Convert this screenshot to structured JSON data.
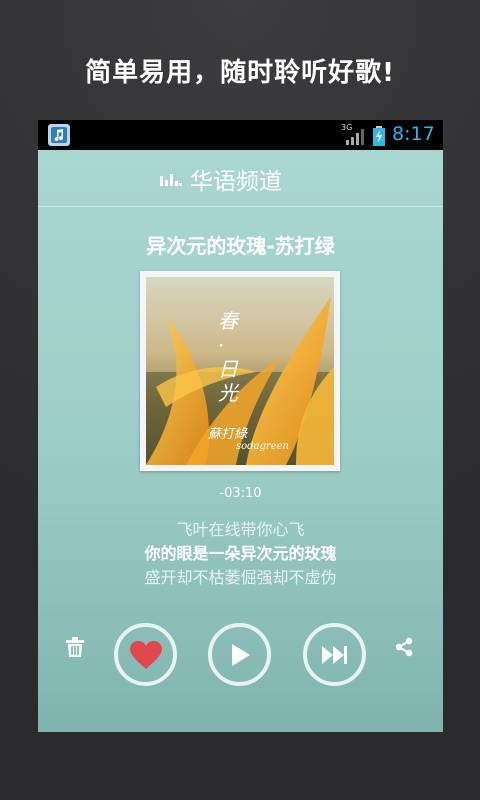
{
  "promo": {
    "title": "简单易用，随时聆听好歌!"
  },
  "statusbar": {
    "time": "8:17",
    "network": "3G",
    "colors": {
      "clock": "#33b5e5",
      "background": "#000000"
    }
  },
  "header": {
    "channel_icon": "equalizer-icon",
    "title": "华语频道"
  },
  "song": {
    "title": "异次元的玫瑰-苏打绿",
    "time_remaining": "-03:10"
  },
  "album_art": {
    "title_text": "春·日光",
    "artist_script": "蘇打綠",
    "artist_latin": "sodagreen"
  },
  "lyrics": {
    "previous": "飞叶在线带你心飞",
    "current": "你的眼是一朵异次元的玫瑰",
    "next": "盛开却不枯萎倔强却不虚伪"
  },
  "controls": {
    "trash": "trash-icon",
    "like": "heart-icon",
    "play": "play-icon",
    "next": "skip-next-icon",
    "share": "share-icon",
    "colors": {
      "heart": "#e0484e",
      "ring": "#e8f3f1",
      "icon": "#ffffff"
    }
  }
}
